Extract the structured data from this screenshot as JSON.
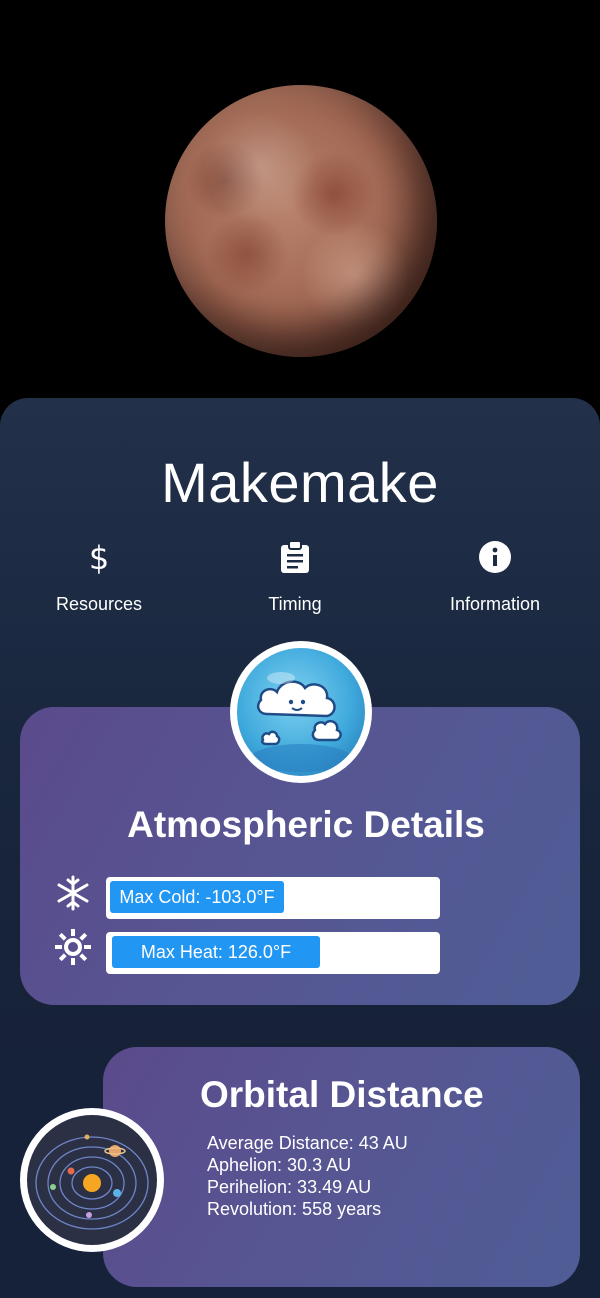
{
  "planet": {
    "name": "Makemake"
  },
  "nav": {
    "items": [
      {
        "label": "Resources",
        "icon": "dollar-icon"
      },
      {
        "label": "Timing",
        "icon": "clipboard-icon"
      },
      {
        "label": "Information",
        "icon": "info-icon"
      }
    ]
  },
  "atmosphere": {
    "title": "Atmospheric Details",
    "icon": "cloud-icon",
    "max_cold": {
      "label": "Max Cold: -103.0°F",
      "icon": "snowflake-icon"
    },
    "max_heat": {
      "label": "Max Heat: 126.0°F",
      "icon": "sun-icon"
    }
  },
  "orbit": {
    "title": "Orbital Distance",
    "icon": "solar-system-icon",
    "average_distance": "Average Distance: 43 AU",
    "aphelion": "Aphelion: 30.3 AU",
    "perihelion": "Perihelion: 33.49 AU",
    "revolution": "Revolution: 558 years"
  },
  "colors": {
    "accent_blue": "#2196f3",
    "card_purple": "#575592",
    "panel_navy": "#1a2840"
  }
}
